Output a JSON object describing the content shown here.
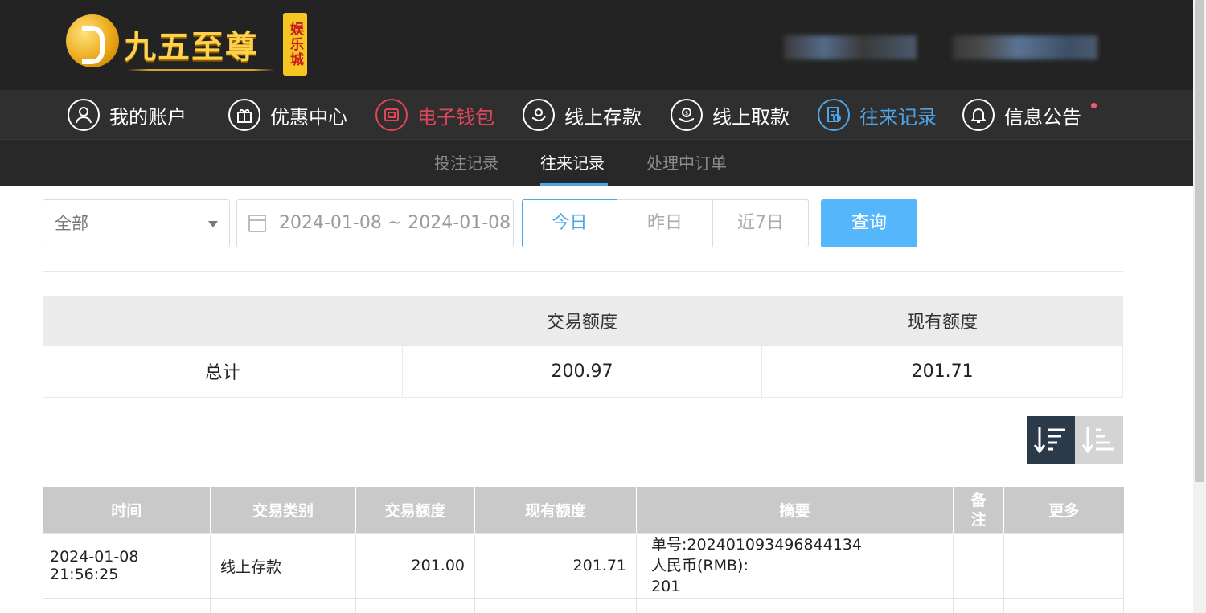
{
  "brand": {
    "name": "九五至尊",
    "badge": "娱乐城"
  },
  "nav": {
    "items": [
      {
        "label": "我的账户",
        "icon": "user-icon"
      },
      {
        "label": "优惠中心",
        "icon": "gift-icon"
      },
      {
        "label": "电子钱包",
        "icon": "wallet-icon"
      },
      {
        "label": "线上存款",
        "icon": "deposit-icon"
      },
      {
        "label": "线上取款",
        "icon": "withdraw-icon"
      },
      {
        "label": "往来记录",
        "icon": "records-icon"
      },
      {
        "label": "信息公告",
        "icon": "bell-icon"
      }
    ]
  },
  "subnav": {
    "items": [
      "投注记录",
      "往来记录",
      "处理中订单"
    ],
    "active": "往来记录"
  },
  "filters": {
    "type_value": "全部",
    "date_range": "2024-01-08 ~ 2024-01-08",
    "quick": [
      "今日",
      "昨日",
      "近7日"
    ],
    "quick_active": "今日",
    "query_label": "查询"
  },
  "summary": {
    "headers": [
      "",
      "交易额度",
      "现有额度"
    ],
    "row": {
      "label": "总计",
      "amount": "200.97",
      "balance": "201.71"
    }
  },
  "records": {
    "headers": [
      "时间",
      "交易类别",
      "交易额度",
      "现有额度",
      "摘要",
      "备注",
      "更多"
    ],
    "rows": [
      {
        "time": "2024-01-08 21:56:25",
        "type": "线上存款",
        "amount": "201.00",
        "balance": "201.71",
        "summary_1": "单号:20240109349684413​4",
        "summary_2": "人民币(RMB):",
        "summary_3": "201",
        "remark": "",
        "more": ""
      }
    ]
  },
  "colors": {
    "header_bg": "#232323",
    "accent_blue": "#4ea6e8",
    "accent_red": "#e0465b",
    "query_bg": "#56b6fb"
  }
}
